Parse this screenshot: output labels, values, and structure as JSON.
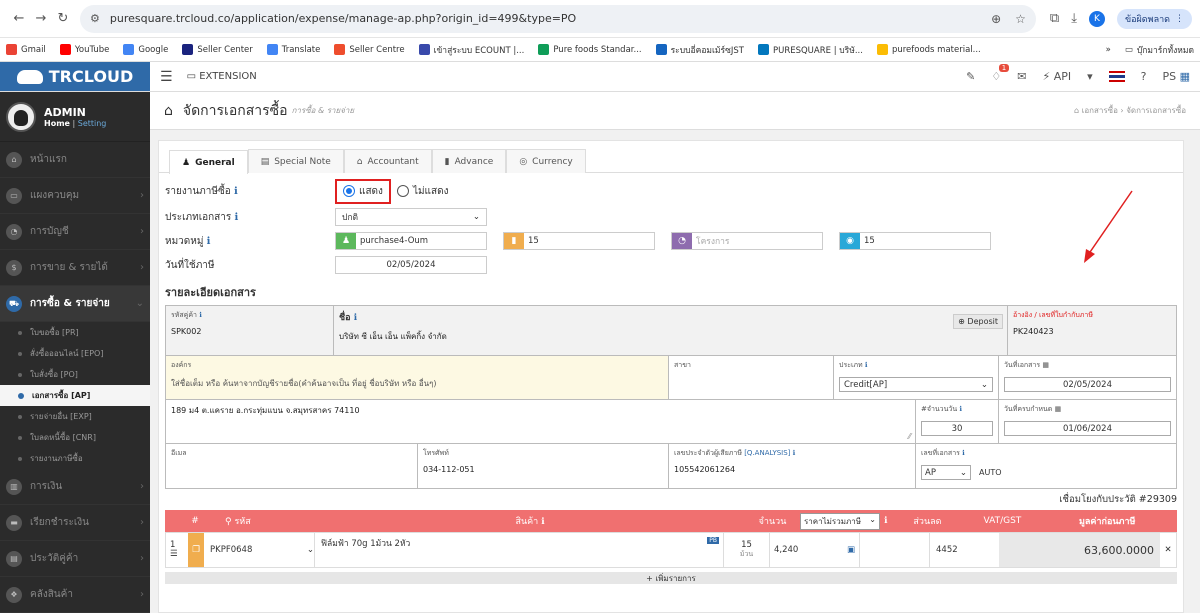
{
  "browser": {
    "url": "puresquare.trcloud.co/application/expense/manage-ap.php?origin_id=499&type=PO",
    "profile_initial": "K",
    "update_label": "ข้อผิดพลาด"
  },
  "bookmarks": [
    "Gmail",
    "YouTube",
    "Google",
    "Seller Center",
    "Translate",
    "Seller Centre",
    "เข้าสู่ระบบ ECOUNT |...",
    "Pure foods Standar...",
    "ระบบอี่คอมเม้ร์ซJST",
    "PURESQUARE | บริษั...",
    "purefoods material..."
  ],
  "bookmarks_right": "บุ๊กมาร์กทั้งหมด",
  "app": {
    "logo": "TRCLOUD",
    "extension": "EXTENSION",
    "api": "API",
    "bell_count": "1",
    "user_short": "PS"
  },
  "sidebar": {
    "user": "ADMIN",
    "home": "Home",
    "setting": "Setting",
    "items": [
      {
        "label": "หน้าแรก"
      },
      {
        "label": "แผงควบคุม"
      },
      {
        "label": "การบัญชี"
      },
      {
        "label": "การขาย & รายได้"
      },
      {
        "label": "การซื้อ & รายจ่าย"
      }
    ],
    "sub": [
      "ใบขอซื้อ [PR]",
      "สั่งซื้อออนไลน์ [EPO]",
      "ใบสั่งซื้อ [PO]",
      "เอกสารซื้อ [AP]",
      "รายจ่ายอื่น [EXP]",
      "ใบลดหนี้ซื้อ [CNR]",
      "รายงานภาษีซื้อ"
    ],
    "bottom": [
      {
        "label": "การเงิน"
      },
      {
        "label": "เรียกชำระเงิน"
      },
      {
        "label": "ประวัติคู่ค้า"
      },
      {
        "label": "คลังสินค้า"
      }
    ]
  },
  "page": {
    "title": "จัดการเอกสารซื้อ",
    "subtitle": "การซื้อ & รายจ่าย",
    "crumb1": "เอกสารซื้อ",
    "crumb2": "จัดการเอกสารซื้อ"
  },
  "tabs": [
    "General",
    "Special Note",
    "Accountant",
    "Advance",
    "Currency"
  ],
  "form": {
    "tax_label": "รายงานภาษีซื้อ",
    "show": "แสดง",
    "hide": "ไม่แสดง",
    "doctype_label": "ประเภทเอกสาร",
    "doctype_value": "ปกติ",
    "group_label": "หมวดหมู่",
    "group_user": "purchase4-Oum",
    "group_a": "15",
    "group_project": "โครงการ",
    "group_b": "15",
    "taxdate_label": "วันที่ใช้ภาษี",
    "taxdate_value": "02/05/2024"
  },
  "details": {
    "title": "รายละเอียดเอกสาร",
    "code_label": "รหัสคู่ค้า",
    "code_value": "SPK002",
    "name_label": "ชื่อ",
    "name_value": "บริษัท ซี เอ็น เอ็น แพ็คกิ้ง จำกัด",
    "deposit": "Deposit",
    "ref_label": "อ้างอิง / เลขที่ใบกำกับภาษี",
    "ref_value": "PK240423",
    "org_label": "องค์กร",
    "org_placeholder": "ใส่ชื่อเต็ม หรือ ค้นหาจากบัญชีรายชื่อ(คำค้นอาจเป็น ที่อยู่ ชื่อบริษัท หรือ อื่นๆ)",
    "branch_label": "สาขา",
    "type_label": "ประเภท",
    "type_value": "Credit[AP]",
    "docdate_label": "วันที่เอกสาร",
    "docdate_value": "02/05/2024",
    "address": "189 ม4 ต.แคราย อ.กระทุ่มแบน จ.สมุทรสาคร 74110",
    "days_label": "#จำนวนวัน",
    "days_value": "30",
    "due_label": "วันที่ครบกำหนด",
    "due_value": "01/06/2024",
    "email_label": "อีเมล",
    "phone_label": "โทรศัพท์",
    "phone_value": "034-112-051",
    "taxid_label": "เลขประจำตัวผู้เสียภาษี",
    "taxid_link": "[Q.ANALYSIS]",
    "taxid_value": "105542061264",
    "docno_label": "เลขที่เอกสาร",
    "docno_value": "AP",
    "docno_auto": "AUTO"
  },
  "history": "เชื่อมโยงกับประวัติ #29309",
  "products": {
    "headers": [
      "#",
      "รหัส",
      "สินค้า",
      "จำนวน",
      "ราคาไม่รวมภาษี",
      "ส่วนลด",
      "VAT/GST",
      "มูลค่าก่อนภาษี"
    ],
    "row": {
      "no": "1",
      "code": "PKPF0648",
      "name": "ฟิล์มฟ้า 70g 1ม้วน 2หัว",
      "qty": "15",
      "unit": "ม้วน",
      "price": "4,240",
      "vat": "4452",
      "total": "63,600.0000"
    },
    "add": "+ เพิ่มรายการ"
  }
}
